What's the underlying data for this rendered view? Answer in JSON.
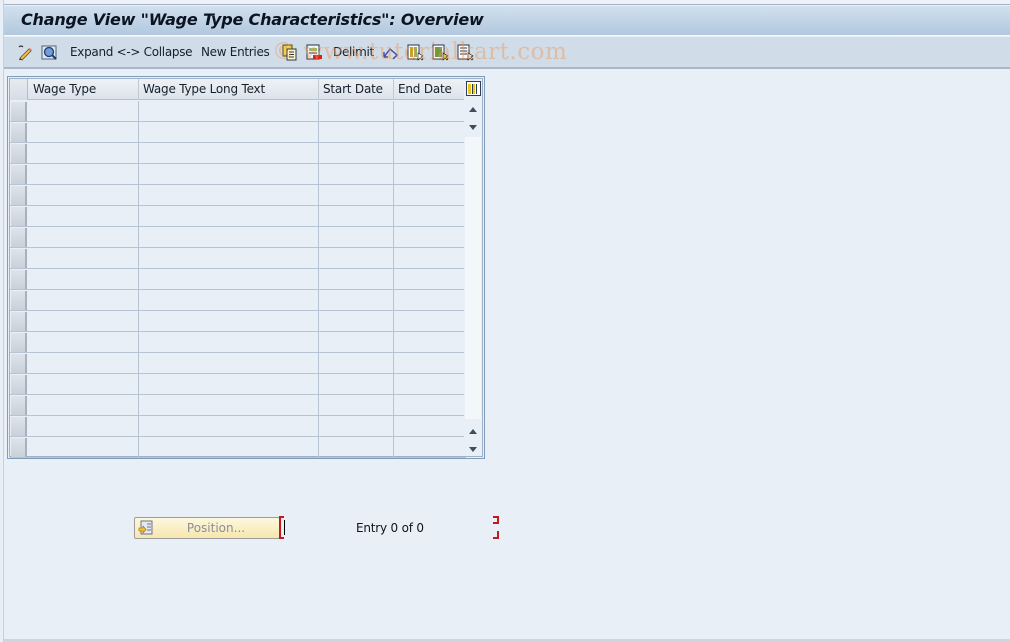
{
  "window": {
    "title": "Change View \"Wage Type Characteristics\": Overview"
  },
  "toolbar": {
    "items": [
      {
        "type": "icon",
        "name": "change-display-icon"
      },
      {
        "type": "icon",
        "name": "details-icon"
      },
      {
        "type": "text",
        "label": "Expand <-> Collapse"
      },
      {
        "type": "text",
        "label": "New Entries"
      },
      {
        "type": "icon",
        "name": "copy-as-icon"
      },
      {
        "type": "icon",
        "name": "delete-icon"
      },
      {
        "type": "text",
        "label": "Delimit"
      },
      {
        "type": "icon",
        "name": "undo-change-icon"
      },
      {
        "type": "icon",
        "name": "select-all-icon"
      },
      {
        "type": "icon",
        "name": "select-block-icon"
      },
      {
        "type": "icon",
        "name": "deselect-all-icon"
      }
    ],
    "expand_collapse_label": "Expand <-> Collapse",
    "new_entries_label": "New Entries",
    "delimit_label": "Delimit"
  },
  "watermark": "© www.tutorialkart.com",
  "table": {
    "columns": [
      "Wage Type",
      "Wage Type Long Text",
      "Start Date",
      "End Date"
    ],
    "rows": [
      [
        "",
        "",
        "",
        ""
      ],
      [
        "",
        "",
        "",
        ""
      ],
      [
        "",
        "",
        "",
        ""
      ],
      [
        "",
        "",
        "",
        ""
      ],
      [
        "",
        "",
        "",
        ""
      ],
      [
        "",
        "",
        "",
        ""
      ],
      [
        "",
        "",
        "",
        ""
      ],
      [
        "",
        "",
        "",
        ""
      ],
      [
        "",
        "",
        "",
        ""
      ],
      [
        "",
        "",
        "",
        ""
      ],
      [
        "",
        "",
        "",
        ""
      ],
      [
        "",
        "",
        "",
        ""
      ],
      [
        "",
        "",
        "",
        ""
      ],
      [
        "",
        "",
        "",
        ""
      ],
      [
        "",
        "",
        "",
        ""
      ],
      [
        "",
        "",
        "",
        ""
      ],
      [
        "",
        "",
        "",
        ""
      ]
    ]
  },
  "footer": {
    "position_button_label": "Position...",
    "entry_text": "Entry 0 of 0"
  },
  "colors": {
    "title_bar": "#b2c8df",
    "toolbar": "#d0dce7",
    "background": "#e8eff7",
    "position_button": "#f7e7ad",
    "bracket": "#c21b1b"
  }
}
